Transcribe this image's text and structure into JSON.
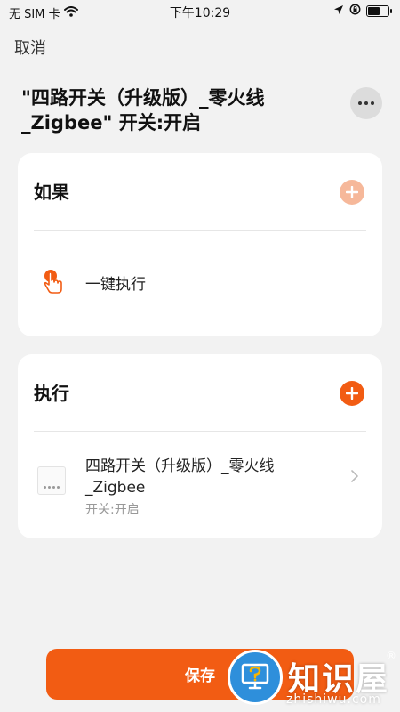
{
  "status_bar": {
    "carrier": "无 SIM 卡",
    "time": "下午10:29"
  },
  "nav": {
    "cancel_label": "取消"
  },
  "scene": {
    "title": "\"四路开关（升级版）_零火线_Zigbee\" 开关:开启"
  },
  "if_card": {
    "header": "如果",
    "condition_label": "一键执行",
    "accent_color": "#f6b89a"
  },
  "do_card": {
    "header": "执行",
    "device_name": "四路开关（升级版）_零火线_Zigbee",
    "device_status": "开关:开启",
    "accent_color": "#f25c13"
  },
  "footer": {
    "save_label": "保存"
  },
  "watermark": {
    "brand": "知识屋",
    "reg_mark": "®",
    "domain": "zhishiwu.com"
  }
}
